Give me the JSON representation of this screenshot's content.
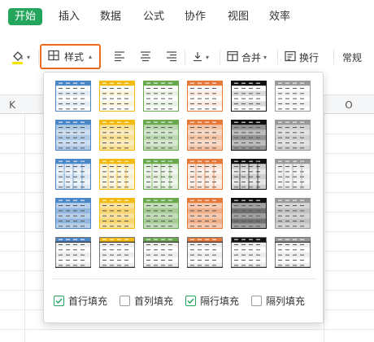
{
  "menu": {
    "tabs": [
      {
        "label": "开始",
        "active": true
      },
      {
        "label": "插入"
      },
      {
        "label": "数据"
      },
      {
        "label": "公式"
      },
      {
        "label": "协作"
      },
      {
        "label": "视图"
      },
      {
        "label": "效率"
      }
    ],
    "accent": "#23a55b"
  },
  "toolbar": {
    "fill_icon": "fill-color-icon",
    "fill_color": "#f5e400",
    "style_label": "样式",
    "style_highlight": "#ec6b1f",
    "merge_label": "合并",
    "wrap_label": "换行",
    "format_label": "常规"
  },
  "sheet": {
    "columns": [
      "K",
      "O"
    ]
  },
  "style_panel": {
    "swatch_colors": [
      "#4a86c8",
      "#f2b90f",
      "#6aa84f",
      "#e5793a",
      "#111111",
      "#999999"
    ],
    "rows": 5,
    "options": [
      {
        "label": "首行填充",
        "checked": true
      },
      {
        "label": "首列填充",
        "checked": false
      },
      {
        "label": "隔行填充",
        "checked": true
      },
      {
        "label": "隔列填充",
        "checked": false
      }
    ]
  }
}
